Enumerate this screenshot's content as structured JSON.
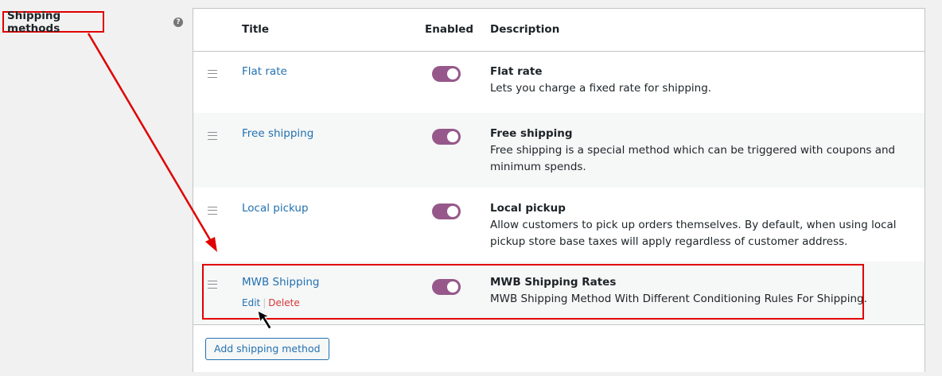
{
  "section": {
    "label": "Shipping methods",
    "help_icon": "question-circle-icon"
  },
  "table": {
    "headers": {
      "title": "Title",
      "enabled": "Enabled",
      "description": "Description"
    },
    "rows": [
      {
        "title": "Flat rate",
        "enabled": true,
        "desc_title": "Flat rate",
        "desc_text": "Lets you charge a fixed rate for shipping."
      },
      {
        "title": "Free shipping",
        "enabled": true,
        "desc_title": "Free shipping",
        "desc_text": "Free shipping is a special method which can be triggered with coupons and minimum spends."
      },
      {
        "title": "Local pickup",
        "enabled": true,
        "desc_title": "Local pickup",
        "desc_text": "Allow customers to pick up orders themselves. By default, when using local pickup store base taxes will apply regardless of customer address."
      },
      {
        "title": "MWB Shipping",
        "enabled": true,
        "desc_title": "MWB Shipping Rates",
        "desc_text": "MWB Shipping Method With Different Conditioning Rules For Shipping.",
        "actions": {
          "edit": "Edit",
          "separator": "|",
          "delete": "Delete"
        }
      }
    ]
  },
  "footer": {
    "add_button": "Add shipping method"
  },
  "colors": {
    "annotation": "#e00000",
    "toggle_on": "#96588a",
    "link": "#2271b1",
    "delete": "#d63638"
  }
}
